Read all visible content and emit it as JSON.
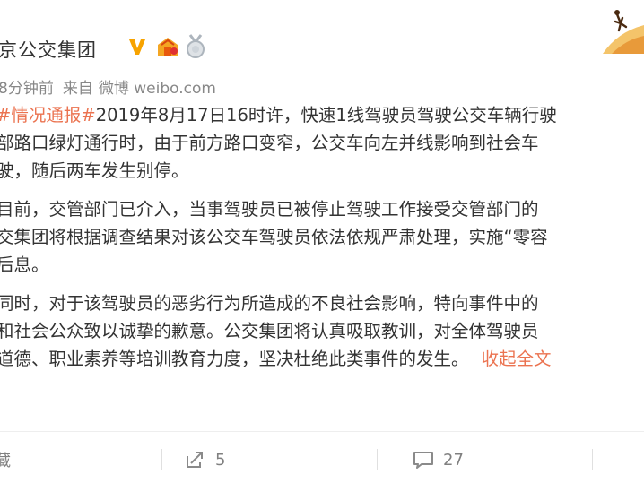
{
  "post": {
    "author": "北京公交集团",
    "author_visible": "京公交集团",
    "meta": {
      "time": "8分钟前",
      "source_prefix": "来自",
      "source_name": "微博",
      "source_url_text": "weibo.com"
    },
    "lines": [
      {
        "tag": "#情况通报#",
        "text": "2019年8月17日16时许，快速1线驾驶员驾驶公交车辆行驶"
      },
      {
        "text": "部路口绿灯通行时，由于前方路口变窄，公交车向左并线影响到社会车"
      },
      {
        "text": "驶，随后两车发生别停。"
      },
      {
        "text": "目前，交管部门已介入，当事驾驶员已被停止驾驶工作接受交管部门的"
      },
      {
        "text": "交集团将根据调查结果对该公交车驾驶员依法依规严肃处理，实施“零容"
      },
      {
        "text": "后息。"
      },
      {
        "text": "同时，对于该驾驶员的恶劣行为所造成的不良社会影响，特向事件中的"
      },
      {
        "text": "和社会公众致以诚挚的歉意。公交集团将认真吸取教训，对全体驾驶员"
      },
      {
        "text": "道德、职业素养等培训教育力度，坚决杜绝此类事件的发生。",
        "link": "收起全文"
      }
    ]
  },
  "actions": {
    "favorite_label": "藏",
    "repost_count": "5",
    "comment_count": "27"
  },
  "colors": {
    "link": "#eb7350",
    "verified": "#f7a300",
    "meta": "#888888",
    "text": "#333333"
  },
  "icons": [
    "verified-badge-icon",
    "member-icon",
    "medal-icon",
    "repost-icon",
    "comment-icon"
  ]
}
